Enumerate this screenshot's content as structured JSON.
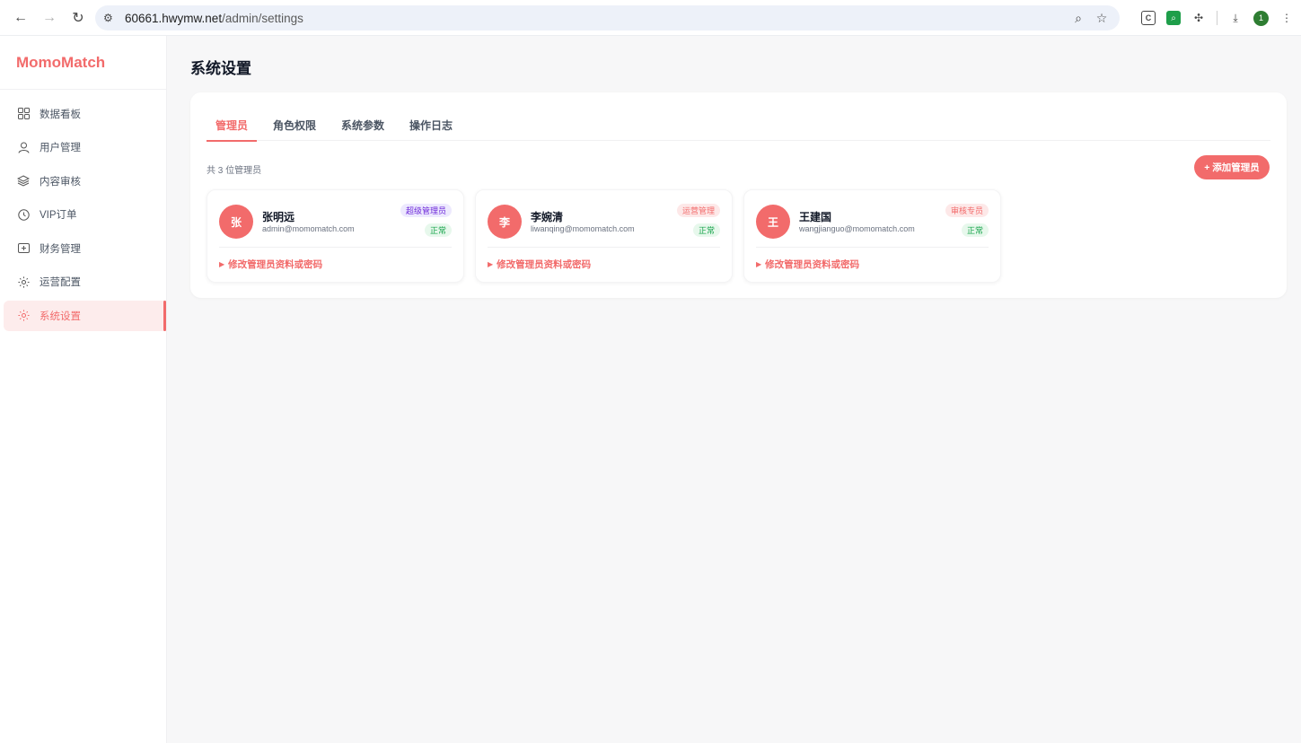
{
  "browser": {
    "url_host": "60661.hwymw.net",
    "url_path": "/admin/settings",
    "profile_initial": "1"
  },
  "sidebar": {
    "brand": "MomoMatch",
    "items": [
      {
        "label": "数据看板",
        "icon": "dashboard-grid-icon"
      },
      {
        "label": "用户管理",
        "icon": "user-icon"
      },
      {
        "label": "内容审核",
        "icon": "layers-icon"
      },
      {
        "label": "VIP订单",
        "icon": "clock-icon"
      },
      {
        "label": "财务管理",
        "icon": "plus-box-icon"
      },
      {
        "label": "运营配置",
        "icon": "sun-icon"
      },
      {
        "label": "系统设置",
        "icon": "sun-icon",
        "active": true
      }
    ]
  },
  "main": {
    "title": "系统设置",
    "tabs": [
      {
        "label": "管理员",
        "active": true
      },
      {
        "label": "角色权限"
      },
      {
        "label": "系统参数"
      },
      {
        "label": "操作日志"
      }
    ],
    "count_text": "共 3 位管理员",
    "add_button": "+ 添加管理员",
    "admins": [
      {
        "initial": "张",
        "name": "张明远",
        "email": "admin@momomatch.com",
        "role": "超级管理员",
        "status": "正常",
        "edit": "修改管理员资料或密码"
      },
      {
        "initial": "李",
        "name": "李婉清",
        "email": "liwanqing@momomatch.com",
        "role": "运营管理",
        "status": "正常",
        "edit": "修改管理员资料或密码"
      },
      {
        "initial": "王",
        "name": "王建国",
        "email": "wangjianguo@momomatch.com",
        "role": "审核专员",
        "status": "正常",
        "edit": "修改管理员资料或密码"
      }
    ]
  },
  "colors": {
    "accent": "#f26b6b",
    "super_badge_bg": "#ede9fe",
    "super_badge_fg": "#6d28d9",
    "status_green": "#16a34a"
  }
}
